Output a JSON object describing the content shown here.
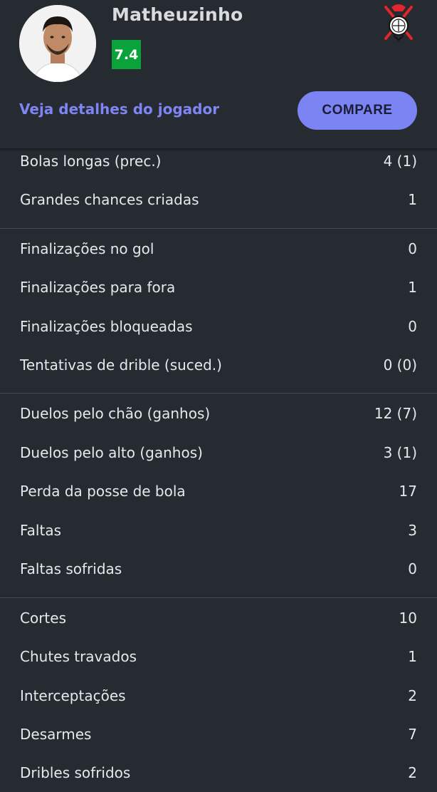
{
  "player": {
    "name": "Matheuzinho",
    "rating": "7.4",
    "details_link": "Veja detalhes do jogador",
    "compare_label": "COMPARE"
  },
  "colors": {
    "background": "#262a31",
    "accent": "#7b84f2",
    "rating_bg": "#0aa23a"
  },
  "icons": {
    "avatar": "player-photo",
    "club": "corinthians-crest"
  },
  "stat_groups": [
    {
      "rows": [
        {
          "label": "Bolas longas (prec.)",
          "value": "4 (1)"
        },
        {
          "label": "Grandes chances criadas",
          "value": "1"
        }
      ]
    },
    {
      "rows": [
        {
          "label": "Finalizações no gol",
          "value": "0"
        },
        {
          "label": "Finalizações para fora",
          "value": "1"
        },
        {
          "label": "Finalizações bloqueadas",
          "value": "0"
        },
        {
          "label": "Tentativas de drible (suced.)",
          "value": "0 (0)"
        }
      ]
    },
    {
      "rows": [
        {
          "label": "Duelos pelo chão (ganhos)",
          "value": "12 (7)"
        },
        {
          "label": "Duelos pelo alto (ganhos)",
          "value": "3 (1)"
        },
        {
          "label": "Perda da posse de bola",
          "value": "17"
        },
        {
          "label": "Faltas",
          "value": "3"
        },
        {
          "label": "Faltas sofridas",
          "value": "0"
        }
      ]
    },
    {
      "rows": [
        {
          "label": "Cortes",
          "value": "10"
        },
        {
          "label": "Chutes travados",
          "value": "1"
        },
        {
          "label": "Interceptações",
          "value": "2"
        },
        {
          "label": "Desarmes",
          "value": "7"
        },
        {
          "label": "Dribles sofridos",
          "value": "2"
        }
      ]
    }
  ]
}
